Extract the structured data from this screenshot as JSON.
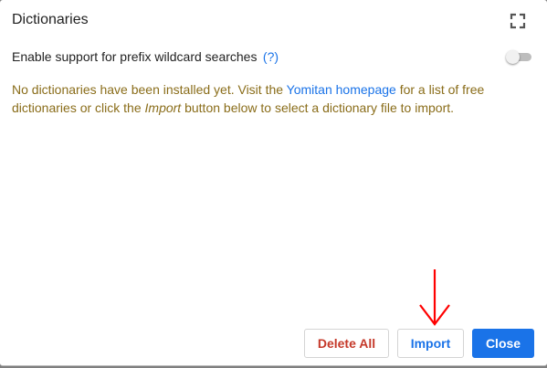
{
  "dialog": {
    "title": "Dictionaries"
  },
  "settings": {
    "prefix_wildcard_label": "Enable support for prefix wildcard searches",
    "help_link": "(?)",
    "prefix_wildcard_enabled": false
  },
  "notice": {
    "part1": "No dictionaries have been installed yet. Visit the ",
    "link_text": "Yomitan homepage",
    "part2": " for a list of free dictionaries or click the ",
    "emphasis": "Import",
    "part3": " button below to select a dictionary file to import."
  },
  "buttons": {
    "delete_all": "Delete All",
    "import": "Import",
    "close": "Close"
  },
  "icons": {
    "fullscreen": "fullscreen-icon",
    "annotation_arrow": "down-arrow-icon"
  },
  "colors": {
    "accent": "#1a73e8",
    "danger": "#c5392a",
    "notice_text": "#8a6d1a",
    "annotation": "#ff0000"
  }
}
